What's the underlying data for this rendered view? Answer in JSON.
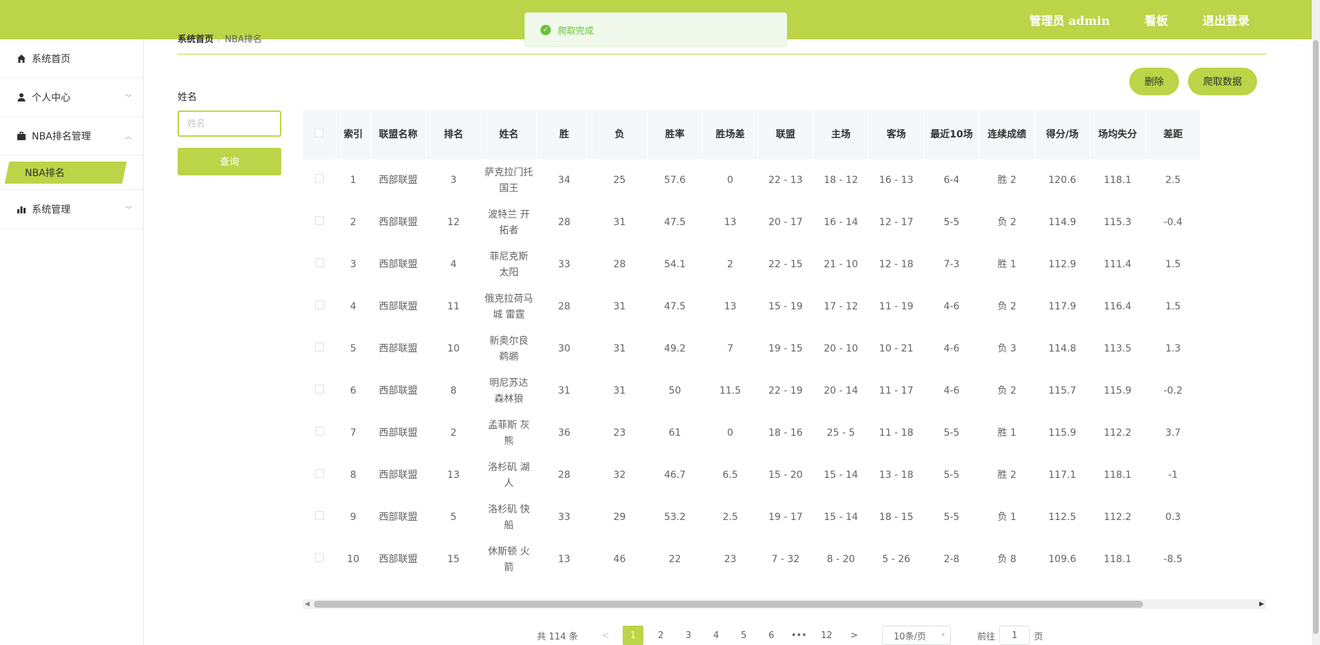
{
  "header": {
    "user": "管理员 admin",
    "dashboard": "看板",
    "logout": "退出登录"
  },
  "toast": {
    "message": "爬取完成"
  },
  "sidebar": {
    "items": [
      {
        "label": "系统首页",
        "icon": "home-icon"
      },
      {
        "label": "个人中心",
        "icon": "user-icon"
      },
      {
        "label": "NBA排名管理",
        "icon": "briefcase-icon"
      },
      {
        "label": "NBA排名",
        "sub": true
      },
      {
        "label": "系统管理",
        "icon": "bar-chart-icon"
      }
    ]
  },
  "breadcrumb": {
    "home": "系统首页",
    "sep": "/",
    "current": "NBA排名"
  },
  "search": {
    "label": "姓名",
    "placeholder": "姓名",
    "button": "查询"
  },
  "actions": {
    "delete": "删除",
    "crawl": "爬取数据"
  },
  "table": {
    "headers": [
      "索引",
      "联盟名称",
      "排名",
      "姓名",
      "胜",
      "负",
      "胜率",
      "胜场差",
      "联盟",
      "主场",
      "客场",
      "最近10场",
      "连续成绩",
      "得分/场",
      "场均失分",
      "差距"
    ],
    "rows": [
      [
        "1",
        "西部联盟",
        "3",
        "萨克拉门托 国王",
        "34",
        "25",
        "57.6",
        "0",
        "22 - 13",
        "18 - 12",
        "16 - 13",
        "6-4",
        "胜 2",
        "120.6",
        "118.1",
        "2.5"
      ],
      [
        "2",
        "西部联盟",
        "12",
        "波特兰 开拓者",
        "28",
        "31",
        "47.5",
        "13",
        "20 - 17",
        "16 - 14",
        "12 - 17",
        "5-5",
        "负 2",
        "114.9",
        "115.3",
        "-0.4"
      ],
      [
        "3",
        "西部联盟",
        "4",
        "菲尼克斯 太阳",
        "33",
        "28",
        "54.1",
        "2",
        "22 - 15",
        "21 - 10",
        "12 - 18",
        "7-3",
        "胜 1",
        "112.9",
        "111.4",
        "1.5"
      ],
      [
        "4",
        "西部联盟",
        "11",
        "俄克拉荷马城 雷霆",
        "28",
        "31",
        "47.5",
        "13",
        "15 - 19",
        "17 - 12",
        "11 - 19",
        "4-6",
        "负 2",
        "117.9",
        "116.4",
        "1.5"
      ],
      [
        "5",
        "西部联盟",
        "10",
        "新奥尔良 鹈鹕",
        "30",
        "31",
        "49.2",
        "7",
        "19 - 15",
        "20 - 10",
        "10 - 21",
        "4-6",
        "负 3",
        "114.8",
        "113.5",
        "1.3"
      ],
      [
        "6",
        "西部联盟",
        "8",
        "明尼苏达 森林狼",
        "31",
        "31",
        "50",
        "11.5",
        "22 - 19",
        "20 - 14",
        "11 - 17",
        "4-6",
        "负 2",
        "115.7",
        "115.9",
        "-0.2"
      ],
      [
        "7",
        "西部联盟",
        "2",
        "孟菲斯 灰熊",
        "36",
        "23",
        "61",
        "0",
        "18 - 16",
        "25 - 5",
        "11 - 18",
        "5-5",
        "胜 1",
        "115.9",
        "112.2",
        "3.7"
      ],
      [
        "8",
        "西部联盟",
        "13",
        "洛杉矶 湖人",
        "28",
        "32",
        "46.7",
        "6.5",
        "15 - 20",
        "15 - 14",
        "13 - 18",
        "5-5",
        "胜 2",
        "117.1",
        "118.1",
        "-1"
      ],
      [
        "9",
        "西部联盟",
        "5",
        "洛杉矶 快船",
        "33",
        "29",
        "53.2",
        "2.5",
        "19 - 17",
        "15 - 14",
        "18 - 15",
        "5-5",
        "负 1",
        "112.5",
        "112.2",
        "0.3"
      ],
      [
        "10",
        "西部联盟",
        "15",
        "休斯顿 火箭",
        "13",
        "46",
        "22",
        "23",
        "7 - 32",
        "8 - 20",
        "5 - 26",
        "2-8",
        "负 8",
        "109.6",
        "118.1",
        "-8.5"
      ]
    ]
  },
  "pagination": {
    "total": "共 114 条",
    "pages": [
      "1",
      "2",
      "3",
      "4",
      "5",
      "6",
      "•••",
      "12"
    ],
    "current": "1",
    "page_size": "10条/页",
    "goto_prefix": "前往",
    "goto_value": "1",
    "goto_suffix": "页"
  },
  "colors": {
    "accent": "#bcd447",
    "success": "#67c23a"
  }
}
